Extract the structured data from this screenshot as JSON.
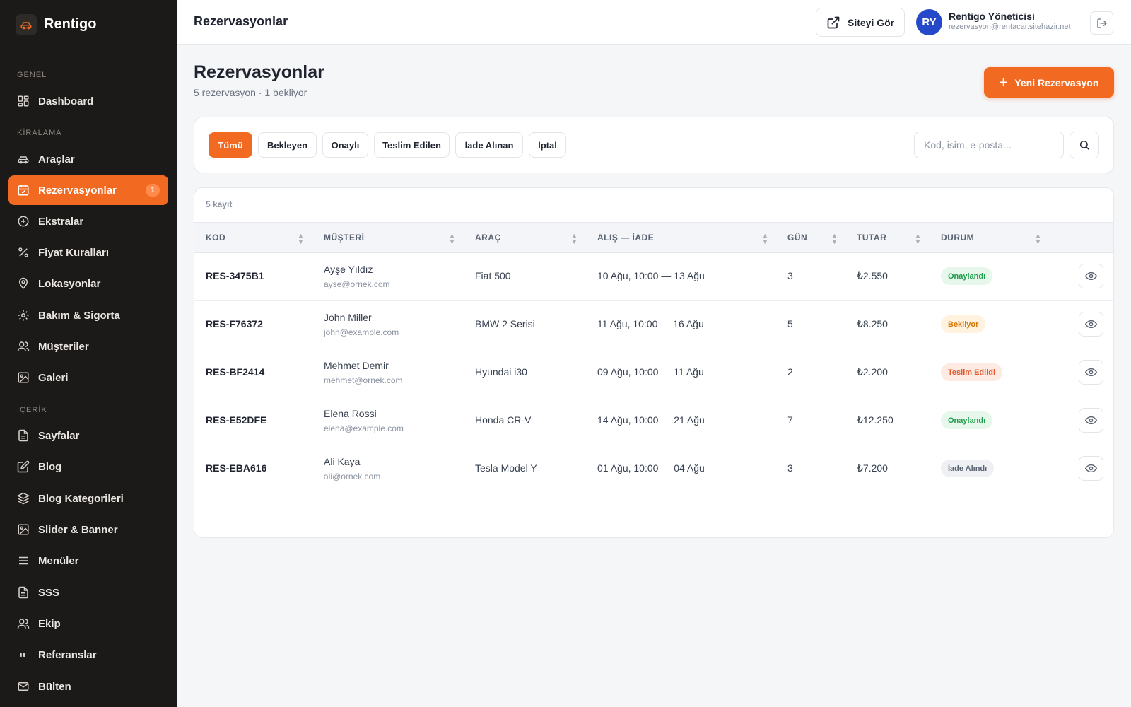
{
  "app": {
    "brand": "Rentigo"
  },
  "sidebar": {
    "sections": [
      {
        "label": "GENEL"
      },
      {
        "label": "KİRALAMA"
      },
      {
        "label": "İÇERİK"
      }
    ],
    "items": [
      {
        "label": "Dashboard",
        "icon": "dashboard-icon"
      },
      {
        "label": "Araçlar",
        "icon": "car-icon"
      },
      {
        "label": "Rezervasyonlar",
        "icon": "calendar-icon",
        "badge": "1",
        "active": true
      },
      {
        "label": "Ekstralar",
        "icon": "plus-circle-icon"
      },
      {
        "label": "Fiyat Kuralları",
        "icon": "percent-icon"
      },
      {
        "label": "Lokasyonlar",
        "icon": "map-pin-icon"
      },
      {
        "label": "Bakım & Sigorta",
        "icon": "gear-icon"
      },
      {
        "label": "Müşteriler",
        "icon": "users-icon"
      },
      {
        "label": "Galeri",
        "icon": "image-icon"
      },
      {
        "label": "Sayfalar",
        "icon": "file-icon"
      },
      {
        "label": "Blog",
        "icon": "edit-icon"
      },
      {
        "label": "Blog Kategorileri",
        "icon": "layers-icon"
      },
      {
        "label": "Slider & Banner",
        "icon": "image-icon"
      },
      {
        "label": "Menüler",
        "icon": "menu-icon"
      },
      {
        "label": "SSS",
        "icon": "file-icon"
      },
      {
        "label": "Ekip",
        "icon": "users-icon"
      },
      {
        "label": "Referanslar",
        "icon": "quote-icon"
      },
      {
        "label": "Bülten",
        "icon": "mail-icon"
      }
    ]
  },
  "header": {
    "title": "Rezervasyonlar",
    "site_button": "Siteyi Gör",
    "user": {
      "initials": "RY",
      "name": "Rentigo Yöneticisi",
      "email": "rezervasyon@rentacar.sitehazir.net"
    }
  },
  "main": {
    "title": "Rezervasyonlar",
    "subtitle": "5 rezervasyon · 1 bekliyor",
    "new_button": "Yeni Rezervasyon",
    "filters": [
      "Tümü",
      "Bekleyen",
      "Onaylı",
      "Teslim Edilen",
      "İade Alınan",
      "İptal"
    ],
    "active_filter": "Tümü",
    "search": {
      "placeholder": "Kod, isim, e-posta...",
      "value": ""
    },
    "record_count": "5 kayıt",
    "columns": [
      "KOD",
      "MÜŞTERİ",
      "ARAÇ",
      "ALIŞ — İADE",
      "GÜN",
      "TUTAR",
      "DURUM"
    ],
    "rows": [
      {
        "code": "RES-3475B1",
        "customer": "Ayşe Yıldız",
        "email": "ayse@ornek.com",
        "vehicle": "Fiat 500",
        "dates": "10 Ağu, 10:00 — 13 Ağu",
        "days": "3",
        "amount": "₺2.550",
        "status": "Onaylandı",
        "status_color": "#1e9e4a"
      },
      {
        "code": "RES-F76372",
        "customer": "John Miller",
        "email": "john@example.com",
        "vehicle": "BMW 2 Serisi",
        "dates": "11 Ağu, 10:00 — 16 Ağu",
        "days": "5",
        "amount": "₺8.250",
        "status": "Bekliyor",
        "status_color": "#d97706"
      },
      {
        "code": "RES-BF2414",
        "customer": "Mehmet Demir",
        "email": "mehmet@ornek.com",
        "vehicle": "Hyundai i30",
        "dates": "09 Ağu, 10:00 — 11 Ağu",
        "days": "2",
        "amount": "₺2.200",
        "status": "Teslim Edildi",
        "status_color": "#e2582b"
      },
      {
        "code": "RES-E52DFE",
        "customer": "Elena Rossi",
        "email": "elena@example.com",
        "vehicle": "Honda CR-V",
        "dates": "14 Ağu, 10:00 — 21 Ağu",
        "days": "7",
        "amount": "₺12.250",
        "status": "Onaylandı",
        "status_color": "#1e9e4a"
      },
      {
        "code": "RES-EBA616",
        "customer": "Ali Kaya",
        "email": "ali@ornek.com",
        "vehicle": "Tesla Model Y",
        "dates": "01 Ağu, 10:00 — 04 Ağu",
        "days": "3",
        "amount": "₺7.200",
        "status": "İade Alındı",
        "status_color": "#5b6472"
      }
    ]
  },
  "colors": {
    "accent": "#f26a21",
    "sidebar_bg": "#1c1a19",
    "avatar": "#2549c8"
  }
}
